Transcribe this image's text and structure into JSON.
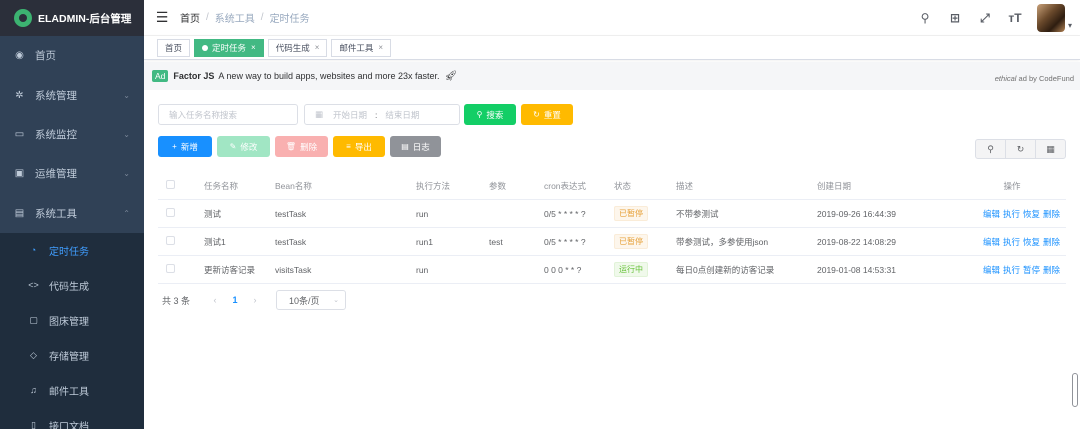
{
  "app": {
    "title": "ELADMIN-后台管理"
  },
  "sidebar": {
    "items": [
      {
        "label": "首页",
        "icon": "dashboard-icon",
        "glyph": "◉",
        "arrow": ""
      },
      {
        "label": "系统管理",
        "icon": "gear-icon",
        "glyph": "✲",
        "arrow": "⌄"
      },
      {
        "label": "系统监控",
        "icon": "monitor-icon",
        "glyph": "▭",
        "arrow": "⌄"
      },
      {
        "label": "运维管理",
        "icon": "server-icon",
        "glyph": "▣",
        "arrow": "⌄"
      },
      {
        "label": "系统工具",
        "icon": "toolbox-icon",
        "glyph": "▤",
        "arrow": "⌃"
      }
    ],
    "sub_items": [
      {
        "label": "定时任务",
        "icon": "timer-icon",
        "glyph": "◔",
        "active": true
      },
      {
        "label": "代码生成",
        "icon": "code-icon",
        "glyph": "<>",
        "active": false
      },
      {
        "label": "图床管理",
        "icon": "image-icon",
        "glyph": "▢",
        "active": false
      },
      {
        "label": "存储管理",
        "icon": "storage-icon",
        "glyph": "◇",
        "active": false
      },
      {
        "label": "邮件工具",
        "icon": "mail-icon",
        "glyph": "♫",
        "active": false
      },
      {
        "label": "接口文档",
        "icon": "doc-icon",
        "glyph": "▯",
        "active": false
      }
    ]
  },
  "navbar": {
    "breadcrumb": [
      "首页",
      "系统工具",
      "定时任务"
    ],
    "separator": "/",
    "icons": [
      {
        "name": "search-icon",
        "glyph": "⚲"
      },
      {
        "name": "github-icon",
        "glyph": "⊞"
      },
      {
        "name": "fullscreen-icon",
        "glyph": "⤢"
      },
      {
        "name": "font-size-icon",
        "glyph": "тT"
      }
    ]
  },
  "tags": [
    {
      "label": "首页",
      "active": false,
      "closable": false
    },
    {
      "label": "定时任务",
      "active": true,
      "closable": true
    },
    {
      "label": "代码生成",
      "active": false,
      "closable": true
    },
    {
      "label": "邮件工具",
      "active": false,
      "closable": true
    }
  ],
  "ad": {
    "badge": "Ad",
    "brand": "Factor JS",
    "text": "A new way to build apps, websites and more 23x faster.",
    "right_em": "ethical",
    "right_text": " ad by CodeFund"
  },
  "filters": {
    "search_placeholder": "输入任务名称搜索",
    "start_placeholder": "开始日期",
    "range_sep": ":",
    "end_placeholder": "结束日期",
    "search_button": "搜索",
    "reset_button": "重置"
  },
  "actions": {
    "add": "新增",
    "edit": "修改",
    "delete": "删除",
    "export": "导出",
    "log": "日志"
  },
  "table": {
    "columns": [
      "任务名称",
      "Bean名称",
      "执行方法",
      "参数",
      "cron表达式",
      "状态",
      "描述",
      "创建日期",
      "操作"
    ],
    "rows": [
      {
        "name": "测试",
        "bean": "testTask",
        "method": "run",
        "params": "",
        "cron": "0/5 * * * * ?",
        "status": "已暂停",
        "status_type": "paused",
        "desc": "不带参测试",
        "date": "2019-09-26 16:44:39",
        "ops": [
          "编辑",
          "执行",
          "恢复",
          "删除"
        ]
      },
      {
        "name": "测试1",
        "bean": "testTask",
        "method": "run1",
        "params": "test",
        "cron": "0/5 * * * * ?",
        "status": "已暂停",
        "status_type": "paused",
        "desc": "带参测试，多参使用json",
        "date": "2019-08-22 14:08:29",
        "ops": [
          "编辑",
          "执行",
          "恢复",
          "删除"
        ]
      },
      {
        "name": "更新访客记录",
        "bean": "visitsTask",
        "method": "run",
        "params": "",
        "cron": "0 0 0 * * ?",
        "status": "运行中",
        "status_type": "running",
        "desc": "每日0点创建新的访客记录",
        "date": "2019-01-08 14:53:31",
        "ops": [
          "编辑",
          "执行",
          "暂停",
          "删除"
        ]
      }
    ]
  },
  "pagination": {
    "total": "共 3 条",
    "current_page": "1",
    "page_size": "10条/页"
  },
  "colors": {
    "sidebar_bg": "#304156",
    "active_tag": "#42b983",
    "primary": "#1890ff",
    "success": "#13ce66",
    "warning": "#ffba00"
  }
}
